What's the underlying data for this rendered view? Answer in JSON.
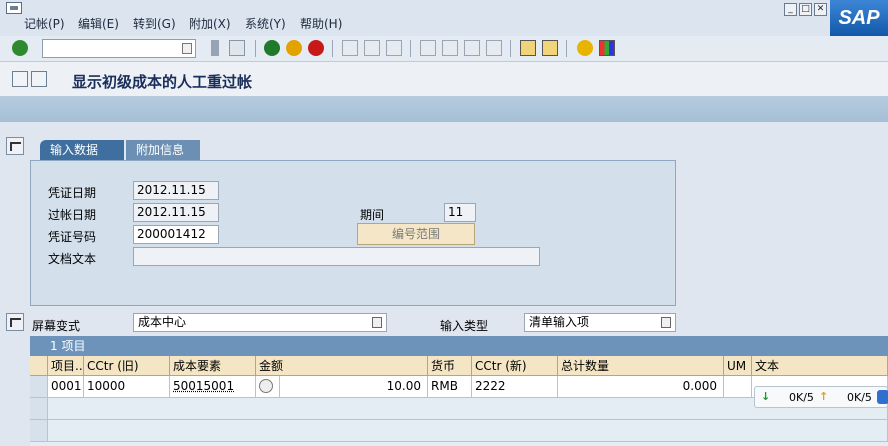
{
  "menu": {
    "items": [
      "记帐(P)",
      "编辑(E)",
      "转到(G)",
      "附加(X)",
      "系统(Y)",
      "帮助(H)"
    ]
  },
  "window": {
    "minimize": "▭",
    "restore": "▭",
    "close": "✕"
  },
  "logo": "SAP",
  "toolbar": {
    "command_value": ""
  },
  "title": "显示初级成本的人工重过帐",
  "tabs": [
    "输入数据",
    "附加信息"
  ],
  "form": {
    "doc_date_label": "凭证日期",
    "doc_date": "2012.11.15",
    "posting_date_label": "过帐日期",
    "posting_date": "2012.11.15",
    "period_label": "期间",
    "period": "11",
    "doc_number_label": "凭证号码",
    "doc_number": "200001412",
    "range_button": "编号范围",
    "doc_text_label": "文档文本",
    "doc_text": ""
  },
  "variant": {
    "screen_variant_label": "屏幕变式",
    "screen_variant": "成本中心",
    "input_type_label": "输入类型",
    "input_type": "清单输入项"
  },
  "table": {
    "title": "1 项目",
    "columns": [
      "项目...",
      "CCtr (旧)",
      "成本要素",
      "金额",
      "货币",
      "CCtr (新)",
      "总计数量",
      "UM",
      "文本"
    ],
    "rows": [
      [
        "0001",
        "10000",
        "50015001",
        "10.00",
        "RMB",
        "2222",
        "0.000",
        "",
        ""
      ]
    ]
  },
  "status": {
    "down_count": "0K/5",
    "up_count": "0K/5"
  }
}
